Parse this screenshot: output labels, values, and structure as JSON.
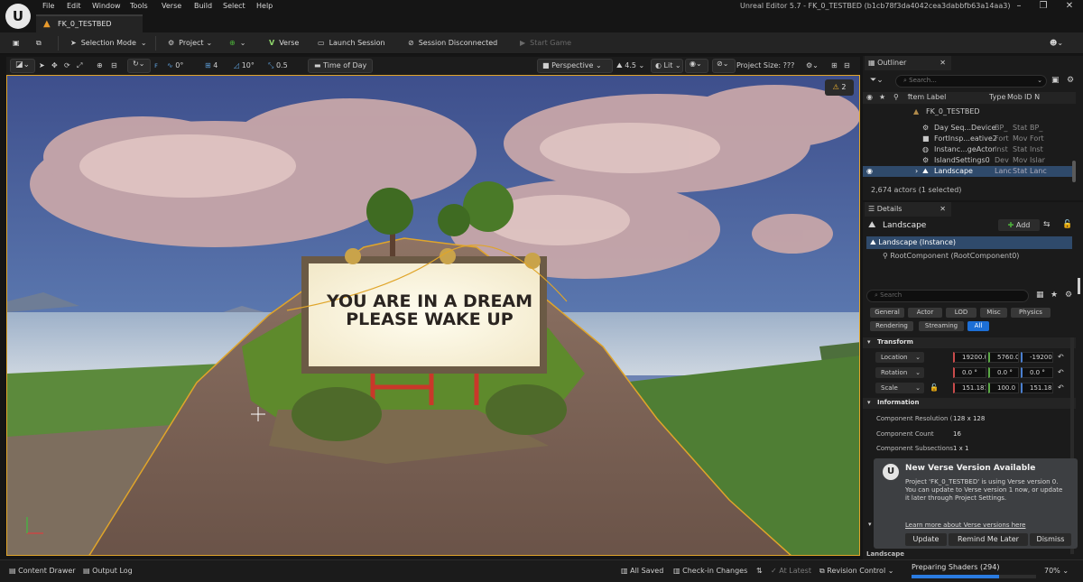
{
  "app": {
    "logo_letter": "U",
    "menu": [
      "File",
      "Edit",
      "Window",
      "Tools",
      "Verse",
      "Build",
      "Select",
      "Help"
    ],
    "window_title": "Unreal Editor 5.7 - FK_0_TESTBED (b1cb78f3da4042cea3dabbfb63a14aa3)",
    "doc_tab": "FK_0_TESTBED"
  },
  "toolbar": {
    "selection_mode": "Selection Mode",
    "project": "Project",
    "verse": "Verse",
    "launch_session": "Launch Session",
    "session_status": "Session Disconnected",
    "start_game": "Start Game"
  },
  "viewport_toolbar": {
    "snap_rotation": "0°",
    "grid_size": "4",
    "rotation_snap": "10°",
    "scale_snap": "0.5",
    "time_of_day": "Time of Day",
    "perspective": "Perspective",
    "camera_speed": "4.5",
    "view_mode": "Lit",
    "project_size": "Project Size: ???",
    "warnings_count": "2"
  },
  "scene": {
    "billboard_line1": "YOU ARE IN A DREAM",
    "billboard_line2": "PLEASE WAKE UP"
  },
  "outliner": {
    "tab": "Outliner",
    "search_placeholder": "Search...",
    "col_label": "Item Label",
    "col_type": "Type",
    "col_mob": "Mob",
    "col_id": "ID N",
    "rows": [
      {
        "label": "FK_0_TESTBED",
        "type": "",
        "mob": "",
        "id": ""
      },
      {
        "label": "Day Seq...Device",
        "type": "BP_",
        "mob": "Stat",
        "id": "BP_"
      },
      {
        "label": "FortInsp...eative2",
        "type": "Fort",
        "mob": "Mov",
        "id": "Fort"
      },
      {
        "label": "Instanc...geActor",
        "type": "Inst",
        "mob": "Stat",
        "id": "Inst"
      },
      {
        "label": "IslandSettings0",
        "type": "Dev",
        "mob": "Mov",
        "id": "Islar"
      },
      {
        "label": "Landscape",
        "type": "Lanc",
        "mob": "Stat",
        "id": "Lanc"
      }
    ],
    "actor_count": "2,674 actors (1 selected)"
  },
  "details": {
    "tab": "Details",
    "title": "Landscape",
    "add_label": "Add",
    "instance": "Landscape (Instance)",
    "root_component": "RootComponent (RootComponent0)",
    "search_placeholder": "Search",
    "filters": [
      "General",
      "Actor",
      "LOD",
      "Misc",
      "Physics",
      "Rendering",
      "Streaming",
      "All"
    ],
    "transform_header": "Transform",
    "location_label": "Location",
    "location": [
      "19200.0",
      "5760.0",
      "-19200.0"
    ],
    "rotation_label": "Rotation",
    "rotation": [
      "0.0 °",
      "0.0 °",
      "0.0 °"
    ],
    "scale_label": "Scale",
    "scale": [
      "151.1811",
      "100.0",
      "151.1811"
    ],
    "information_header": "Information",
    "info": [
      {
        "label": "Component Resolution (",
        "value": "128 x 128"
      },
      {
        "label": "Component Count",
        "value": "16"
      },
      {
        "label": "Component Subsections",
        "value": "1 x 1"
      }
    ],
    "landscape_header": "Landscape"
  },
  "notification": {
    "title": "New Verse Version Available",
    "body1": "Project 'FK_0_TESTBED' is using Verse version 0.",
    "body2": "You can update to Verse version 1 now, or update it later through Project Settings.",
    "link": "Learn more about Verse versions here",
    "update": "Update",
    "remind": "Remind Me Later",
    "dismiss": "Dismiss"
  },
  "statusbar": {
    "content_drawer": "Content Drawer",
    "output_log": "Output Log",
    "all_saved": "All Saved",
    "checkin": "Check-in Changes",
    "at_latest": "At Latest",
    "revision_control": "Revision Control",
    "preparing_shaders": "Preparing Shaders (294)",
    "shader_progress": 0.7,
    "shader_percent": "70%"
  },
  "colors": {
    "accent": "#e0a52a",
    "selected": "#2f4a6b",
    "all_filter": "#1d6fd6",
    "add_green": "#4caf3a"
  }
}
